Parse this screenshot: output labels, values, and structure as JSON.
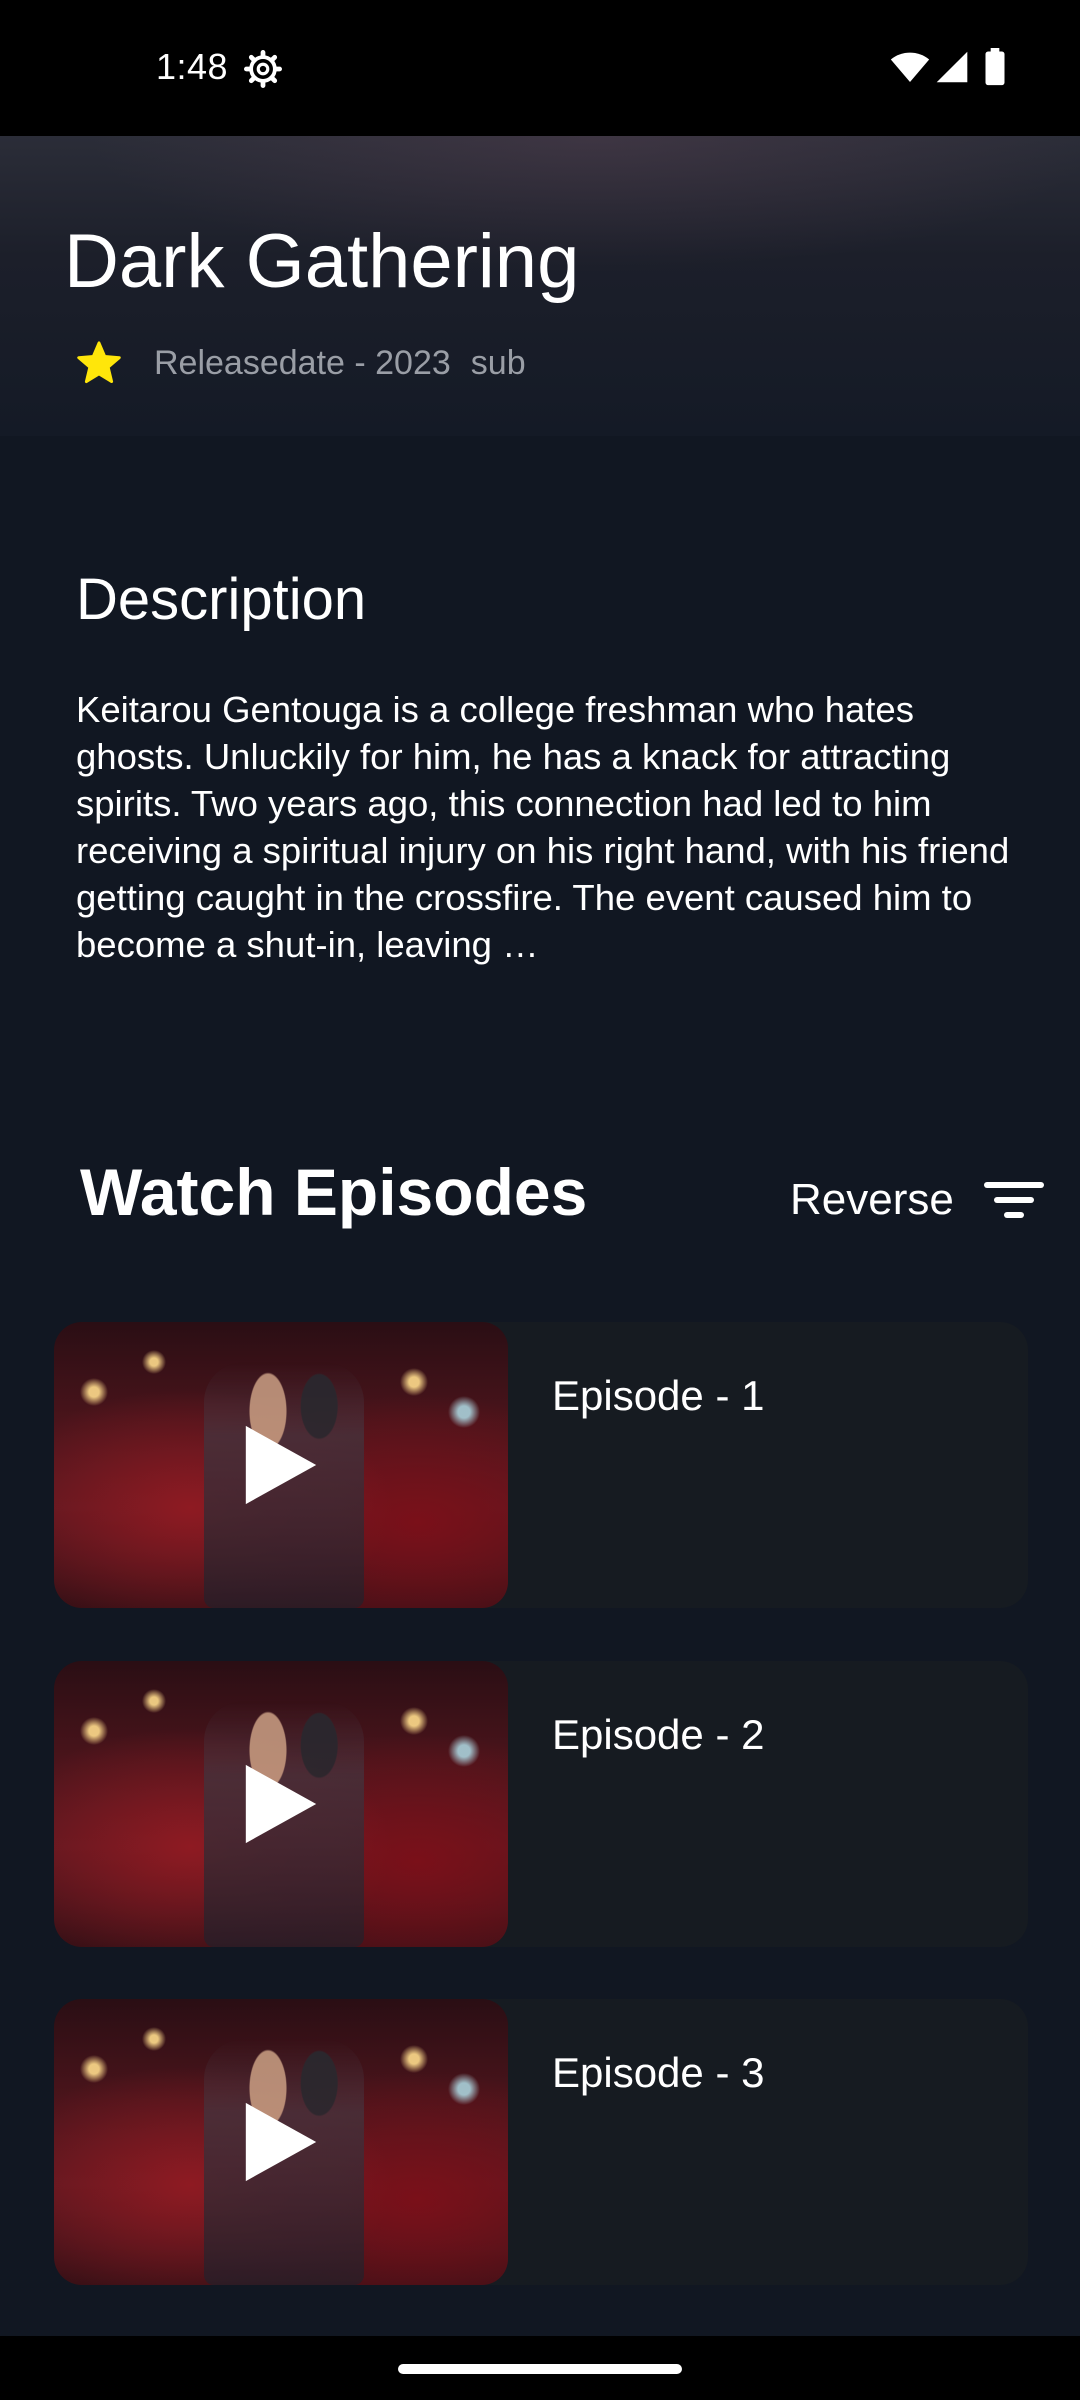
{
  "status_bar": {
    "time": "1:48",
    "icons": [
      "settings-gear-icon",
      "wifi-icon",
      "signal-icon",
      "battery-icon"
    ]
  },
  "show": {
    "title": "Dark Gathering",
    "release": "Releasedate - 2023",
    "type": "sub",
    "icon": "star-icon",
    "accent_color": "#ffe60a"
  },
  "description": {
    "heading": "Description",
    "text": "Keitarou Gentouga is a college freshman who hates ghosts. Unluckily for him, he has a knack for attracting spirits. Two years ago, this connection had led to him receiving a spiritual injury on his right hand, with his friend getting caught in the crossfire. The event caused him to become a shut-in, leaving …"
  },
  "episodes": {
    "heading": "Watch Episodes",
    "sort_label": "Reverse",
    "sort_icon": "filter-icon",
    "items": [
      {
        "label": "Episode - 1",
        "icon": "play-icon"
      },
      {
        "label": "Episode - 2",
        "icon": "play-icon"
      },
      {
        "label": "Episode - 3",
        "icon": "play-icon"
      }
    ]
  }
}
